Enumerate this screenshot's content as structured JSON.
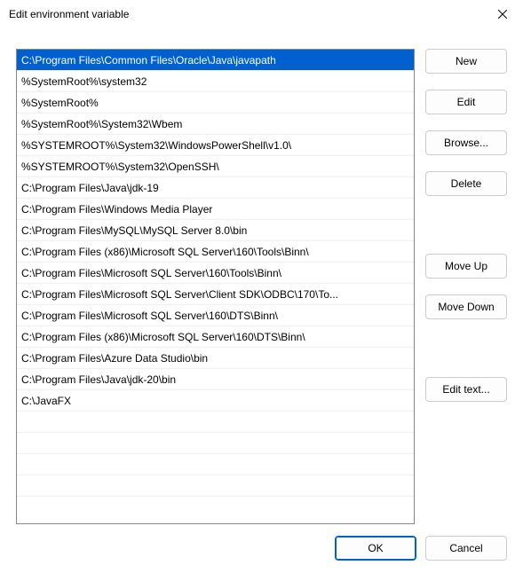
{
  "window": {
    "title": "Edit environment variable"
  },
  "paths": [
    "C:\\Program Files\\Common Files\\Oracle\\Java\\javapath",
    "%SystemRoot%\\system32",
    "%SystemRoot%",
    "%SystemRoot%\\System32\\Wbem",
    "%SYSTEMROOT%\\System32\\WindowsPowerShell\\v1.0\\",
    "%SYSTEMROOT%\\System32\\OpenSSH\\",
    "C:\\Program Files\\Java\\jdk-19",
    "C:\\Program Files\\Windows Media Player",
    "C:\\Program Files\\MySQL\\MySQL Server 8.0\\bin",
    "C:\\Program Files (x86)\\Microsoft SQL Server\\160\\Tools\\Binn\\",
    "C:\\Program Files\\Microsoft SQL Server\\160\\Tools\\Binn\\",
    "C:\\Program Files\\Microsoft SQL Server\\Client SDK\\ODBC\\170\\To...",
    "C:\\Program Files\\Microsoft SQL Server\\160\\DTS\\Binn\\",
    "C:\\Program Files (x86)\\Microsoft SQL Server\\160\\DTS\\Binn\\",
    "C:\\Program Files\\Azure Data Studio\\bin",
    "C:\\Program Files\\Java\\jdk-20\\bin",
    "C:\\JavaFX"
  ],
  "selected_index": 0,
  "buttons": {
    "new": "New",
    "edit": "Edit",
    "browse": "Browse...",
    "delete": "Delete",
    "move_up": "Move Up",
    "move_down": "Move Down",
    "edit_text": "Edit text...",
    "ok": "OK",
    "cancel": "Cancel"
  }
}
